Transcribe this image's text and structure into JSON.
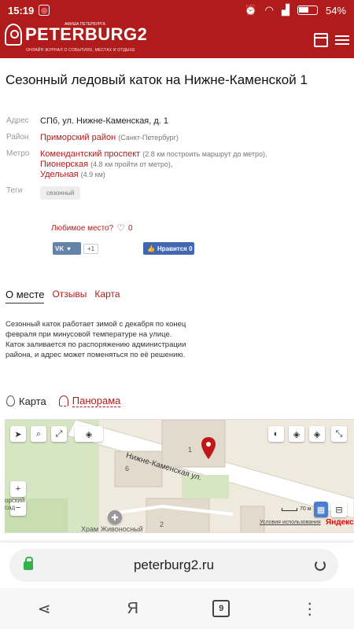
{
  "status": {
    "time": "15:19",
    "battery": "54%"
  },
  "header": {
    "logo": "PETERBURG2",
    "logo_top": "АФИША ПЕТЕРБУРГА",
    "logo_sub": "ОНЛАЙН ЖУРНАЛ О СОБЫТИЯХ, МЕСТАХ И ОТДЫХЕ"
  },
  "place": {
    "title": "Сезонный ледовый каток на Нижне-Каменской 1",
    "address_label": "Адрес",
    "address": "СПб, ул. Нижне-Каменская, д. 1",
    "district_label": "Район",
    "district": "Приморский район",
    "district_note": "(Санкт-Петербург)",
    "metro_label": "Метро",
    "metro": [
      {
        "name": "Комендантский проспект",
        "note": "(2.8 км построить маршрут до метро),"
      },
      {
        "name": "Пионерская",
        "note": "(4.8 км пройти от метро),"
      },
      {
        "name": "Удельная",
        "note": "(4.9 км)"
      }
    ],
    "tags_label": "Теги",
    "tag": "сезонный",
    "favorite": "Любимое место?",
    "favorite_count": "0"
  },
  "social": {
    "vk_label": "VK",
    "vk_count": "+1",
    "fb_label": "Нравится 0"
  },
  "tabs": [
    {
      "label": "О месте"
    },
    {
      "label": "Отзывы"
    },
    {
      "label": "Карта"
    }
  ],
  "description": "Сезонный каток работает зимой с декабря по конец февраля при минусовой температуре на улице. Каток заливается по распоряжению администрации района, и адрес может поменяться по её решению.",
  "map": {
    "tab_map": "Карта",
    "tab_pano": "Панорама",
    "street": "Нижне-Каменская ул.",
    "church": "Храм Живоносный",
    "park": "орский\nсад",
    "building_1": "1",
    "building_2": "2",
    "building_6": "6",
    "scale": "70 м",
    "terms": "Условия использования",
    "brand": "Яндекс",
    "zoom_in": "+",
    "zoom_out": "−"
  },
  "browser": {
    "url": "peterburg2.ru",
    "tabs_count": "9",
    "yandex_glyph": "Я"
  },
  "colors": {
    "brand": "#b01c1c",
    "lock": "#33b24a"
  }
}
